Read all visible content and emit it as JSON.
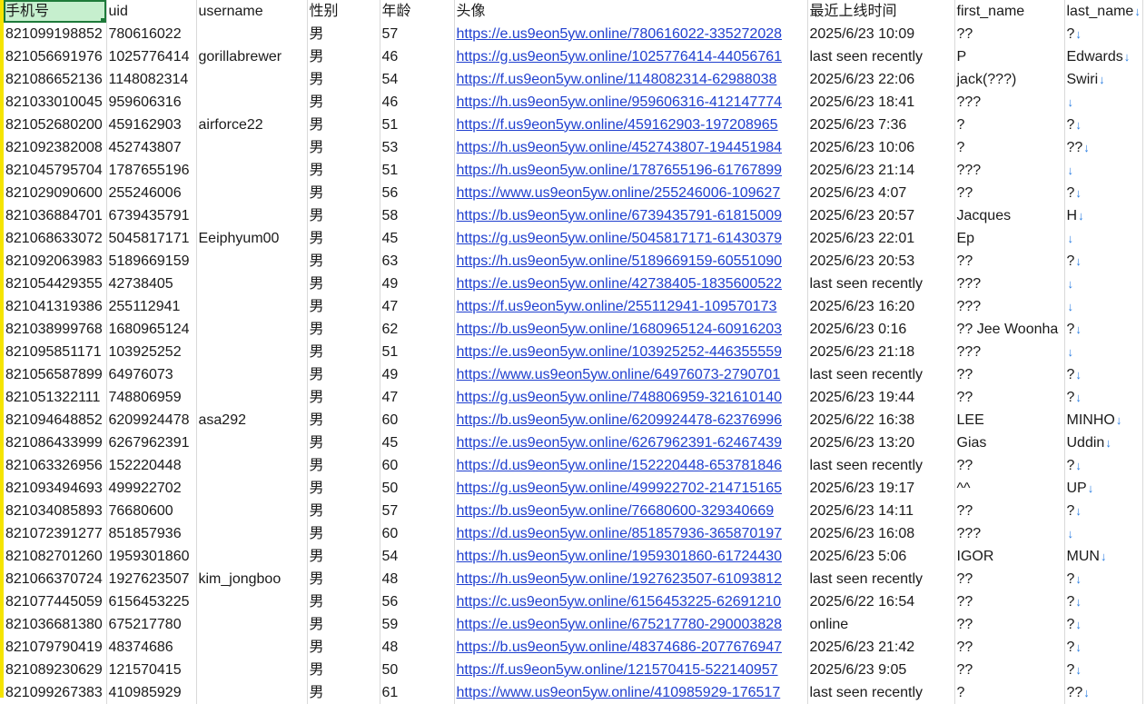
{
  "columns": [
    "手机号",
    "uid",
    "username",
    "性别",
    "年龄",
    "头像",
    "最近上线时间",
    "first_name",
    "last_name"
  ],
  "rows": [
    [
      "821099198852",
      "780616022",
      "",
      "男",
      "57",
      "https://e.us9eon5yw.online/780616022-335272028",
      "2025/6/23 10:09",
      "??",
      "?"
    ],
    [
      "821056691976",
      "1025776414",
      "gorillabrewer",
      "男",
      "46",
      "https://g.us9eon5yw.online/1025776414-44056761",
      "last seen recently",
      "P",
      "Edwards"
    ],
    [
      "821086652136",
      "1148082314",
      "",
      "男",
      "54",
      "https://f.us9eon5yw.online/1148082314-62988038",
      "2025/6/23 22:06",
      "jack(???)",
      "Swiri"
    ],
    [
      "821033010045",
      "959606316",
      "",
      "男",
      "46",
      "https://h.us9eon5yw.online/959606316-412147774",
      "2025/6/23 18:41",
      "???",
      ""
    ],
    [
      "821052680200",
      "459162903",
      "airforce22",
      "男",
      "51",
      "https://f.us9eon5yw.online/459162903-197208965",
      "2025/6/23 7:36",
      "?",
      "?"
    ],
    [
      "821092382008",
      "452743807",
      "",
      "男",
      "53",
      "https://h.us9eon5yw.online/452743807-194451984",
      "2025/6/23 10:06",
      "?",
      "??"
    ],
    [
      "821045795704",
      "1787655196",
      "",
      "男",
      "51",
      "https://h.us9eon5yw.online/1787655196-61767899",
      "2025/6/23 21:14",
      "???",
      ""
    ],
    [
      "821029090600",
      "255246006",
      "",
      "男",
      "56",
      "https://www.us9eon5yw.online/255246006-109627",
      "2025/6/23 4:07",
      "??",
      "?"
    ],
    [
      "821036884701",
      "6739435791",
      "",
      "男",
      "58",
      "https://b.us9eon5yw.online/6739435791-61815009",
      "2025/6/23 20:57",
      "Jacques",
      "H"
    ],
    [
      "821068633072",
      "5045817171",
      "Eeiphyum00",
      "男",
      "45",
      "https://g.us9eon5yw.online/5045817171-61430379",
      "2025/6/23 22:01",
      "Ep",
      ""
    ],
    [
      "821092063983",
      "5189669159",
      "",
      "男",
      "63",
      "https://h.us9eon5yw.online/5189669159-60551090",
      "2025/6/23 20:53",
      "??",
      "?"
    ],
    [
      "821054429355",
      "42738405",
      "",
      "男",
      "49",
      "https://e.us9eon5yw.online/42738405-1835600522",
      "last seen recently",
      "???",
      ""
    ],
    [
      "821041319386",
      "255112941",
      "",
      "男",
      "47",
      "https://f.us9eon5yw.online/255112941-109570173",
      "2025/6/23 16:20",
      "???",
      ""
    ],
    [
      "821038999768",
      "1680965124",
      "",
      "男",
      "62",
      "https://b.us9eon5yw.online/1680965124-60916203",
      "2025/6/23 0:16",
      "?? Jee Woonha",
      "?"
    ],
    [
      "821095851171",
      "103925252",
      "",
      "男",
      "51",
      "https://e.us9eon5yw.online/103925252-446355559",
      "2025/6/23 21:18",
      "???",
      ""
    ],
    [
      "821056587899",
      "64976073",
      "",
      "男",
      "49",
      "https://www.us9eon5yw.online/64976073-2790701",
      "last seen recently",
      "??",
      "?"
    ],
    [
      "821051322111",
      "748806959",
      "",
      "男",
      "47",
      "https://g.us9eon5yw.online/748806959-321610140",
      "2025/6/23 19:44",
      "??",
      "?"
    ],
    [
      "821094648852",
      "6209924478",
      "asa292",
      "男",
      "60",
      "https://b.us9eon5yw.online/6209924478-62376996",
      "2025/6/22 16:38",
      "LEE",
      "MINHO"
    ],
    [
      "821086433999",
      "6267962391",
      "",
      "男",
      "45",
      "https://e.us9eon5yw.online/6267962391-62467439",
      "2025/6/23 13:20",
      "Gias",
      "Uddin"
    ],
    [
      "821063326956",
      "152220448",
      "",
      "男",
      "60",
      "https://d.us9eon5yw.online/152220448-653781846",
      "last seen recently",
      "??",
      "?"
    ],
    [
      "821093494693",
      "499922702",
      "",
      "男",
      "50",
      "https://g.us9eon5yw.online/499922702-214715165",
      "2025/6/23 19:17",
      "^^",
      "UP"
    ],
    [
      "821034085893",
      "76680600",
      "",
      "男",
      "57",
      "https://b.us9eon5yw.online/76680600-329340669",
      "2025/6/23 14:11",
      "??",
      "?"
    ],
    [
      "821072391277",
      "851857936",
      "",
      "男",
      "60",
      "https://d.us9eon5yw.online/851857936-365870197",
      "2025/6/23 16:08",
      "???",
      ""
    ],
    [
      "821082701260",
      "1959301860",
      "",
      "男",
      "54",
      "https://h.us9eon5yw.online/1959301860-61724430",
      "2025/6/23 5:06",
      "IGOR",
      "MUN"
    ],
    [
      "821066370724",
      "1927623507",
      "kim_jongboo",
      "男",
      "48",
      "https://h.us9eon5yw.online/1927623507-61093812",
      "last seen recently",
      "??",
      "?"
    ],
    [
      "821077445059",
      "6156453225",
      "",
      "男",
      "56",
      "https://c.us9eon5yw.online/6156453225-62691210",
      "2025/6/22 16:54",
      "??",
      "?"
    ],
    [
      "821036681380",
      "675217780",
      "",
      "男",
      "59",
      "https://e.us9eon5yw.online/675217780-290003828",
      "online",
      "??",
      "?"
    ],
    [
      "821079790419",
      "48374686",
      "",
      "男",
      "48",
      "https://b.us9eon5yw.online/48374686-2077676947",
      "2025/6/23 21:42",
      "??",
      "?"
    ],
    [
      "821089230629",
      "121570415",
      "",
      "男",
      "50",
      "https://f.us9eon5yw.online/121570415-522140957",
      "2025/6/23 9:05",
      "??",
      "?"
    ],
    [
      "821099267383",
      "410985929",
      "",
      "男",
      "61",
      "https://www.us9eon5yw.online/410985929-176517",
      "last seen recently",
      "?",
      "??"
    ]
  ],
  "filter_arrow": "↓",
  "accent": {
    "link": "#1f3fcf",
    "selection": "#1e7a3a",
    "gutter": "#f5e400",
    "arrow": "#2a7de1"
  }
}
